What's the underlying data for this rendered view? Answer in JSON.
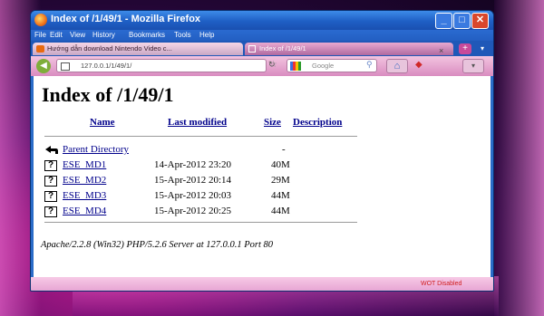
{
  "window": {
    "title": "Index of /1/49/1 - Mozilla Firefox",
    "controls": {
      "minimize": "_",
      "maximize": "□",
      "close": "✕"
    }
  },
  "menu": [
    "File",
    "Edit",
    "View",
    "History",
    "Bookmarks",
    "Tools",
    "Help"
  ],
  "tabs": [
    {
      "label": "Hướng dẫn download Nintendo Video c...",
      "active": false
    },
    {
      "label": "Index of /1/49/1",
      "active": true,
      "close": "×"
    }
  ],
  "tab_new_label": "+",
  "navbar": {
    "url": "127.0.0.1/1/49/1/",
    "search_placeholder": "Google"
  },
  "page": {
    "heading": "Index of /1/49/1",
    "columns": [
      "Name",
      "Last modified",
      "Size",
      "Description"
    ],
    "parent": {
      "name": "Parent Directory",
      "size": "-"
    },
    "rows": [
      {
        "name": "ESE_MD1",
        "modified": "14-Apr-2012 23:20",
        "size": "40M"
      },
      {
        "name": "ESE_MD2",
        "modified": "15-Apr-2012 20:14",
        "size": "29M"
      },
      {
        "name": "ESE_MD3",
        "modified": "15-Apr-2012 20:03",
        "size": "44M"
      },
      {
        "name": "ESE_MD4",
        "modified": "15-Apr-2012 20:25",
        "size": "44M"
      }
    ],
    "footer": "Apache/2.2.8 (Win32) PHP/5.2.6 Server at 127.0.0.1 Port 80"
  },
  "status": {
    "text": "WOT Disabled"
  },
  "colors": {
    "link": "#00008b",
    "title_bar": "#1f5fc5",
    "tab_active": "#b06aa0"
  }
}
